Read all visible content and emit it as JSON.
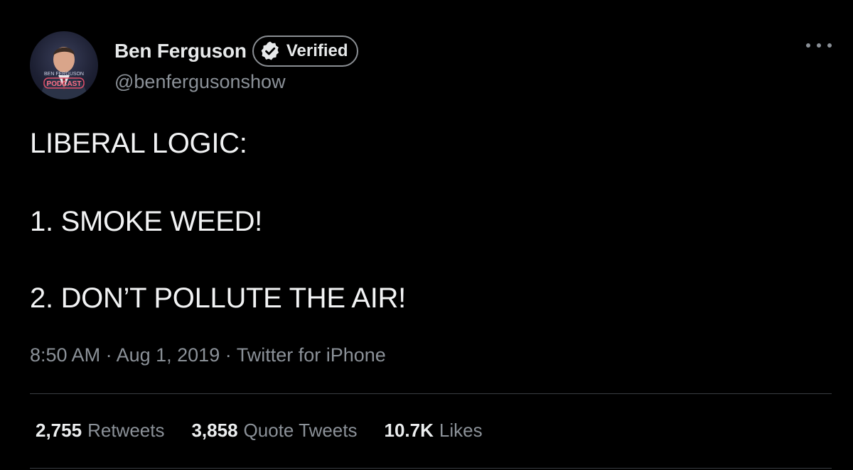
{
  "author": {
    "display_name": "Ben Ferguson",
    "verified_label": "Verified",
    "handle": "@benfergusonshow",
    "avatar_logo_text": "BEN FERGUSON",
    "avatar_logo_sub": "PODCAST"
  },
  "tweet": {
    "lines": [
      "LIBERAL LOGIC:",
      "1. SMOKE WEED!",
      "2. DON’T POLLUTE THE AIR!"
    ],
    "time": "8:50 AM",
    "date": "Aug 1, 2019",
    "source": "Twitter for iPhone",
    "separator": " · "
  },
  "stats": {
    "retweets_count": "2,755",
    "retweets_label": "Retweets",
    "quotes_count": "3,858",
    "quotes_label": "Quote Tweets",
    "likes_count": "10.7K",
    "likes_label": "Likes"
  },
  "colors": {
    "background": "#000000",
    "text_primary": "#e7e9ea",
    "text_secondary": "#8b9198",
    "divider": "#3a3e42",
    "logo_neon": "#e0506a"
  },
  "icons": {
    "verified": "verified-check-icon",
    "more": "more-horizontal-icon"
  }
}
